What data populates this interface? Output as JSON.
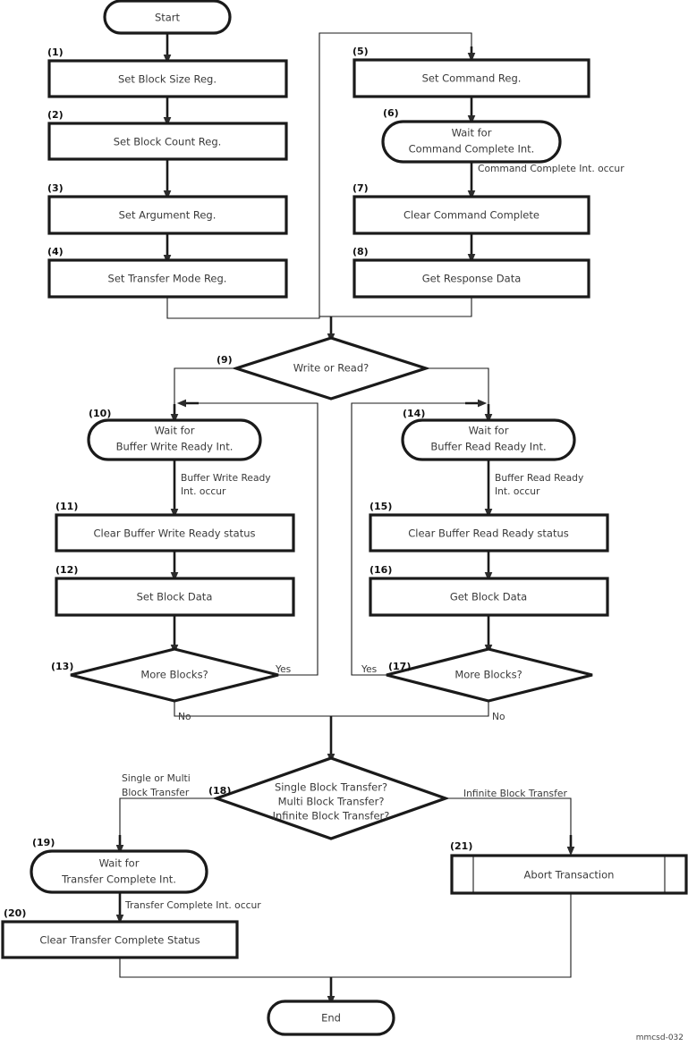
{
  "diagram": {
    "caption": "mmcsd-032",
    "colors": {
      "stroke": "#1a1a1a",
      "text": "#3a3a3a",
      "background": "#ffffff"
    },
    "terminals": {
      "start": "Start",
      "end": "End"
    },
    "steps": [
      {
        "num": "(1)",
        "label": "Set Block Size Reg.",
        "shape": "process"
      },
      {
        "num": "(2)",
        "label": "Set Block Count Reg.",
        "shape": "process"
      },
      {
        "num": "(3)",
        "label": "Set Argument Reg.",
        "shape": "process"
      },
      {
        "num": "(4)",
        "label": "Set Transfer Mode Reg.",
        "shape": "process"
      },
      {
        "num": "(5)",
        "label": "Set Command Reg.",
        "shape": "process"
      },
      {
        "num": "(6)",
        "label_line1": "Wait for",
        "label_line2": "Command Complete Int.",
        "shape": "wait"
      },
      {
        "num": "(7)",
        "label": "Clear Command Complete",
        "shape": "process"
      },
      {
        "num": "(8)",
        "label": "Get Response Data",
        "shape": "process"
      },
      {
        "num": "(9)",
        "label": "Write or Read?",
        "shape": "decision"
      },
      {
        "num": "(10)",
        "label_line1": "Wait for",
        "label_line2": "Buffer Write Ready Int.",
        "shape": "wait"
      },
      {
        "num": "(11)",
        "label": "Clear Buffer Write Ready status",
        "shape": "process"
      },
      {
        "num": "(12)",
        "label": "Set Block Data",
        "shape": "process"
      },
      {
        "num": "(13)",
        "label": "More Blocks?",
        "shape": "decision"
      },
      {
        "num": "(14)",
        "label_line1": "Wait for",
        "label_line2": "Buffer Read Ready Int.",
        "shape": "wait"
      },
      {
        "num": "(15)",
        "label": "Clear Buffer Read Ready status",
        "shape": "process"
      },
      {
        "num": "(16)",
        "label": "Get Block Data",
        "shape": "process"
      },
      {
        "num": "(17)",
        "label": "More Blocks?",
        "shape": "decision"
      },
      {
        "num": "(18)",
        "label_line1": "Single Block Transfer?",
        "label_line2": "Multi Block Transfer?",
        "label_line3": "Infinite Block Transfer?",
        "shape": "decision"
      },
      {
        "num": "(19)",
        "label_line1": "Wait for",
        "label_line2": "Transfer Complete Int.",
        "shape": "wait"
      },
      {
        "num": "(20)",
        "label": "Clear Transfer Complete Status",
        "shape": "process"
      },
      {
        "num": "(21)",
        "label": "Abort Transaction",
        "shape": "predefined-process"
      }
    ],
    "edge_labels": {
      "command_complete_occur": "Command Complete Int. occur",
      "buffer_write_ready_occur_l1": "Buffer Write Ready",
      "buffer_write_ready_occur_l2": "Int. occur",
      "buffer_read_ready_occur_l1": "Buffer Read Ready",
      "buffer_read_ready_occur_l2": "Int. occur",
      "yes_left": "Yes",
      "no_left": "No",
      "yes_right": "Yes",
      "no_right": "No",
      "single_or_multi_l1": "Single or Multi",
      "single_or_multi_l2": "Block Transfer",
      "infinite_block_transfer": "Infinite Block Transfer",
      "transfer_complete_occur": "Transfer Complete Int. occur"
    }
  }
}
